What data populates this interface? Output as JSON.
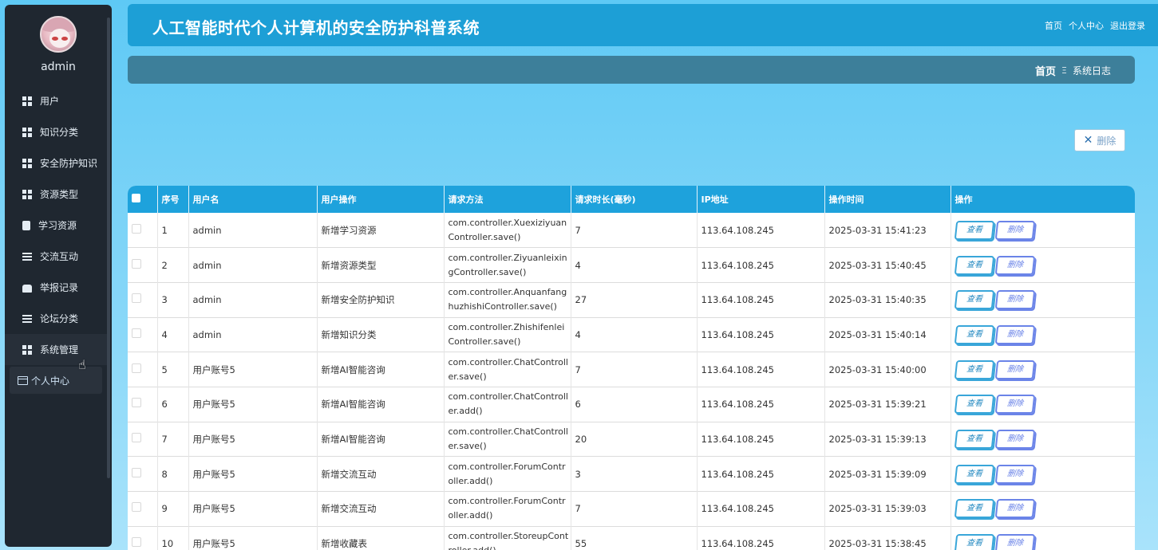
{
  "header": {
    "title": "人工智能时代个人计算机的安全防护科普系统",
    "links": [
      "首页",
      "个人中心",
      "退出登录"
    ]
  },
  "sidebar": {
    "username": "admin",
    "items": [
      {
        "label": "用户",
        "icon": "grid-icon"
      },
      {
        "label": "知识分类",
        "icon": "grid-icon"
      },
      {
        "label": "安全防护知识",
        "icon": "grid-icon"
      },
      {
        "label": "资源类型",
        "icon": "grid-icon"
      },
      {
        "label": "学习资源",
        "icon": "clipboard-icon"
      },
      {
        "label": "交流互动",
        "icon": "list-icon"
      },
      {
        "label": "举报记录",
        "icon": "hand-icon"
      },
      {
        "label": "论坛分类",
        "icon": "list-icon"
      },
      {
        "label": "系统管理",
        "icon": "grid-icon"
      }
    ],
    "submenu": {
      "label": "个人中心",
      "icon": "window-icon"
    }
  },
  "breadcrumb": {
    "home": "首页",
    "separator": "Ξ",
    "current": "系统日志"
  },
  "toolbar": {
    "delete_label": "删除"
  },
  "table": {
    "columns": [
      "序号",
      "用户名",
      "用户操作",
      "请求方法",
      "请求时长(毫秒)",
      "IP地址",
      "操作时间",
      "操作"
    ],
    "view_label": "查看",
    "delete_label": "删除",
    "rows": [
      {
        "no": "1",
        "user": "admin",
        "op": "新增学习资源",
        "method": "com.controller.XuexiziyuanController.save()",
        "ms": "7",
        "ip": "113.64.108.245",
        "time": "2025-03-31 15:41:23"
      },
      {
        "no": "2",
        "user": "admin",
        "op": "新增资源类型",
        "method": "com.controller.ZiyuanleixingController.save()",
        "ms": "4",
        "ip": "113.64.108.245",
        "time": "2025-03-31 15:40:45"
      },
      {
        "no": "3",
        "user": "admin",
        "op": "新增安全防护知识",
        "method": "com.controller.AnquanfanghuzhishiController.save()",
        "ms": "27",
        "ip": "113.64.108.245",
        "time": "2025-03-31 15:40:35"
      },
      {
        "no": "4",
        "user": "admin",
        "op": "新增知识分类",
        "method": "com.controller.ZhishifenleiController.save()",
        "ms": "4",
        "ip": "113.64.108.245",
        "time": "2025-03-31 15:40:14"
      },
      {
        "no": "5",
        "user": "用户账号5",
        "op": "新增AI智能咨询",
        "method": "com.controller.ChatController.save()",
        "ms": "7",
        "ip": "113.64.108.245",
        "time": "2025-03-31 15:40:00"
      },
      {
        "no": "6",
        "user": "用户账号5",
        "op": "新增AI智能咨询",
        "method": "com.controller.ChatController.add()",
        "ms": "6",
        "ip": "113.64.108.245",
        "time": "2025-03-31 15:39:21"
      },
      {
        "no": "7",
        "user": "用户账号5",
        "op": "新增AI智能咨询",
        "method": "com.controller.ChatController.save()",
        "ms": "20",
        "ip": "113.64.108.245",
        "time": "2025-03-31 15:39:13"
      },
      {
        "no": "8",
        "user": "用户账号5",
        "op": "新增交流互动",
        "method": "com.controller.ForumController.add()",
        "ms": "3",
        "ip": "113.64.108.245",
        "time": "2025-03-31 15:39:09"
      },
      {
        "no": "9",
        "user": "用户账号5",
        "op": "新增交流互动",
        "method": "com.controller.ForumController.add()",
        "ms": "7",
        "ip": "113.64.108.245",
        "time": "2025-03-31 15:39:03"
      },
      {
        "no": "10",
        "user": "用户账号5",
        "op": "新增收藏表",
        "method": "com.controller.StoreupController.add()",
        "ms": "55",
        "ip": "113.64.108.245",
        "time": "2025-03-31 15:38:45"
      }
    ]
  }
}
